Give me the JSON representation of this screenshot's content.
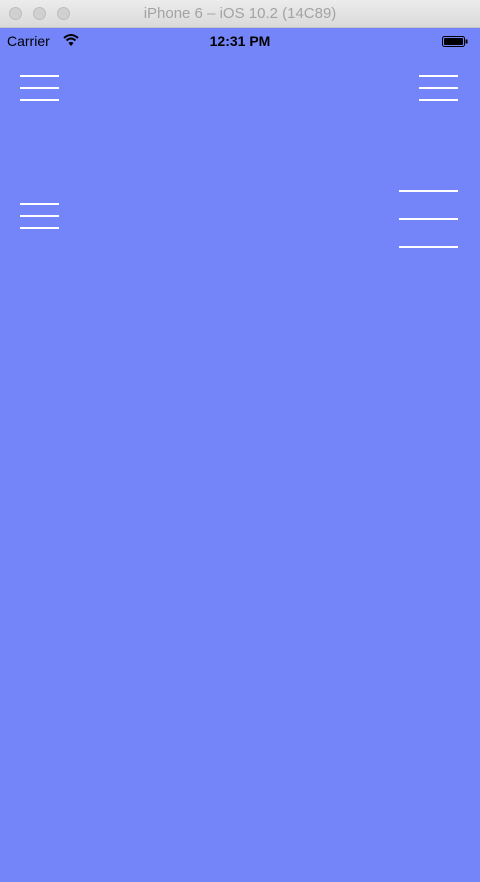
{
  "window": {
    "title": "iPhone 6 – iOS 10.2 (14C89)"
  },
  "status_bar": {
    "carrier": "Carrier",
    "time": "12:31 PM",
    "icons": [
      "wifi-icon",
      "battery-icon"
    ]
  },
  "screen": {
    "background_color": "#7385f8",
    "menu_buttons": [
      {
        "icon": "hamburger-menu-icon",
        "position": "top-left"
      },
      {
        "icon": "hamburger-menu-icon",
        "position": "top-right"
      },
      {
        "icon": "hamburger-menu-icon",
        "position": "middle-left"
      },
      {
        "icon": "hamburger-menu-icon",
        "position": "middle-right-large"
      }
    ],
    "icon_color": "#ffffff"
  }
}
